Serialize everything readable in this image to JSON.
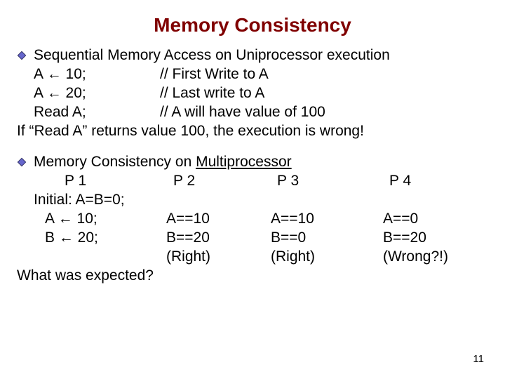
{
  "title": "Memory Consistency",
  "sec1": {
    "heading": "Sequential Memory Access on Uniprocessor execution",
    "l1a": "A ",
    "l1b": " 10;",
    "l1c": "// First Write to A",
    "l2a": "A ",
    "l2b": " 20;",
    "l2c": "// Last write to A",
    "l3a": "Read A;",
    "l3c": "// A will have value of 100",
    "footer": "If “Read A” returns value 100, the execution is wrong!"
  },
  "sec2": {
    "heading": "Memory Consistency on ",
    "heading_u": "Multiprocessor",
    "h1": "P 1",
    "h2": "P 2",
    "h3": "P 3",
    "h4": "P 4",
    "init": "Initial: A=B=0;",
    "r1a": "A ",
    "r1b": " 10;",
    "r1_p2": "A==10",
    "r1_p3": "A==10",
    "r1_p4": "A==0",
    "r2a": "B ",
    "r2b": " 20;",
    "r2_p2": "B==20",
    "r2_p3": "B==0",
    "r2_p4": "B==20",
    "r3_p2": "(Right)",
    "r3_p3": "(Right)",
    "r3_p4": "(Wrong?!)",
    "footer": "What was expected?"
  },
  "arrow": "←",
  "page": "11"
}
